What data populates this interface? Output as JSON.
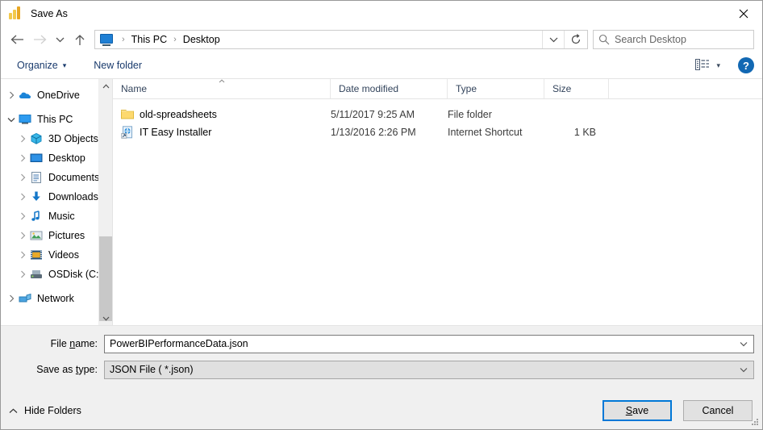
{
  "window": {
    "title": "Save As",
    "app_icon": "powerbi-icon",
    "close_label": "✕"
  },
  "nav": {
    "back": "back-arrow-icon",
    "forward": "forward-arrow-icon",
    "recent": "chevron-down-icon",
    "up": "up-arrow-icon",
    "breadcrumb": {
      "icon": "this-pc-icon",
      "items": [
        "This PC",
        "Desktop"
      ],
      "separator": "›"
    },
    "address_dropdown": "chevron-down-icon",
    "refresh": "refresh-icon",
    "search": {
      "icon": "search-icon",
      "placeholder": "Search Desktop",
      "value": ""
    }
  },
  "toolbar": {
    "organize_label": "Organize",
    "organize_caret": "▾",
    "new_folder_label": "New folder",
    "view_icon": "view-layout-icon",
    "view_caret": "▾",
    "help_label": "?"
  },
  "sidebar": {
    "items": [
      {
        "label": "OneDrive",
        "icon": "onedrive-cloud-icon",
        "level": 1,
        "expanded": false
      },
      {
        "label": "This PC",
        "icon": "this-pc-icon",
        "level": 1,
        "expanded": true
      },
      {
        "label": "3D Objects",
        "icon": "3d-objects-icon",
        "level": 2,
        "expanded": false
      },
      {
        "label": "Desktop",
        "icon": "desktop-icon",
        "level": 2,
        "expanded": false
      },
      {
        "label": "Documents",
        "icon": "documents-icon",
        "level": 2,
        "expanded": false
      },
      {
        "label": "Downloads",
        "icon": "downloads-icon",
        "level": 2,
        "expanded": false
      },
      {
        "label": "Music",
        "icon": "music-icon",
        "level": 2,
        "expanded": false
      },
      {
        "label": "Pictures",
        "icon": "pictures-icon",
        "level": 2,
        "expanded": false
      },
      {
        "label": "Videos",
        "icon": "videos-icon",
        "level": 2,
        "expanded": false
      },
      {
        "label": "OSDisk (C:)",
        "icon": "hard-drive-icon",
        "level": 2,
        "expanded": false
      },
      {
        "label": "Network",
        "icon": "network-icon",
        "level": 1,
        "expanded": false
      }
    ]
  },
  "filelist": {
    "columns": [
      {
        "label": "Name",
        "sorted": "asc"
      },
      {
        "label": "Date modified",
        "sorted": ""
      },
      {
        "label": "Type",
        "sorted": ""
      },
      {
        "label": "Size",
        "sorted": ""
      }
    ],
    "rows": [
      {
        "name": "old-spreadsheets",
        "icon": "folder-icon",
        "date": "5/11/2017 9:25 AM",
        "type": "File folder",
        "size": ""
      },
      {
        "name": "IT Easy Installer",
        "icon": "internet-shortcut-icon",
        "date": "1/13/2016 2:26 PM",
        "type": "Internet Shortcut",
        "size": "1 KB"
      }
    ]
  },
  "form": {
    "filename_label_pre": "File ",
    "filename_label_key": "n",
    "filename_label_post": "ame:",
    "filename_value": "PowerBIPerformanceData.json",
    "filetype_label_pre": "Save as ",
    "filetype_label_key": "t",
    "filetype_label_post": "ype:",
    "filetype_value": "JSON File  ( *.json)",
    "dropdown_icon": "chevron-down-icon"
  },
  "footer": {
    "hide_folders_caret": "chevron-up-icon",
    "hide_folders_label": "Hide Folders",
    "save_pre": "",
    "save_key": "S",
    "save_post": "ave",
    "cancel_label": "Cancel"
  },
  "colors": {
    "accent": "#0078d7",
    "brand_yellow": "#f2c94c",
    "help_blue": "#1268b3",
    "chrome_gray": "#f0f0f0"
  }
}
